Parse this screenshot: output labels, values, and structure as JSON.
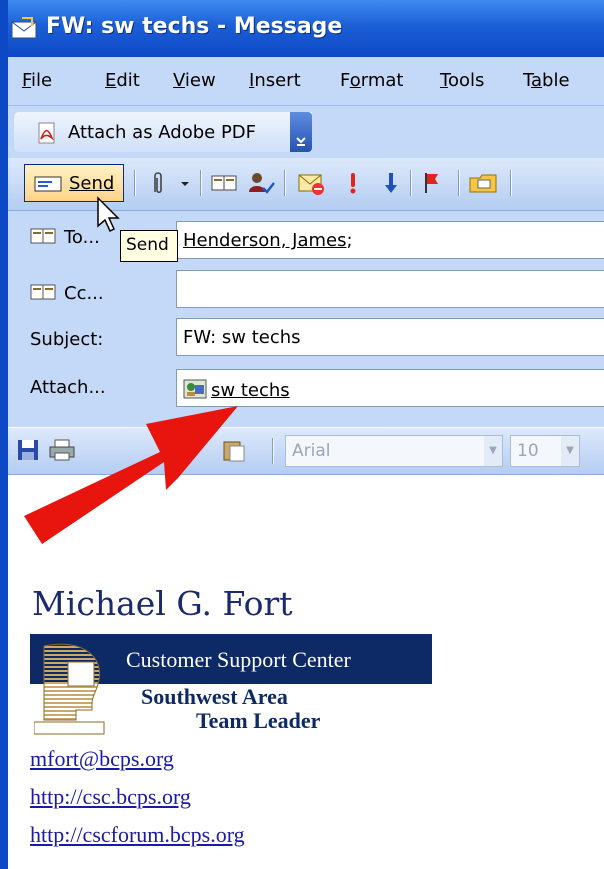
{
  "window": {
    "title": "FW: sw techs - Message"
  },
  "menu": {
    "items": [
      {
        "pre": "",
        "u": "F",
        "post": "ile"
      },
      {
        "pre": "",
        "u": "E",
        "post": "dit"
      },
      {
        "pre": "",
        "u": "V",
        "post": "iew"
      },
      {
        "pre": "",
        "u": "I",
        "post": "nsert"
      },
      {
        "pre": "F",
        "u": "o",
        "post": "rmat"
      },
      {
        "pre": "",
        "u": "T",
        "post": "ools"
      },
      {
        "pre": "T",
        "u": "a",
        "post": "ble"
      }
    ]
  },
  "pdf_toolbar": {
    "attach_label": "Attach as Adobe PDF"
  },
  "std_toolbar": {
    "send_label": "Send"
  },
  "tooltip": {
    "text": "Send"
  },
  "header": {
    "to_label": "To...",
    "to_value": "Henderson, James",
    "to_sep": ";",
    "cc_label": "Cc...",
    "cc_value": "",
    "subject_label": "Subject:",
    "subject_value": "FW: sw techs",
    "attach_label": "Attach...",
    "attach_value": "sw techs"
  },
  "format_toolbar": {
    "font": "Arial",
    "size": "10"
  },
  "signature": {
    "name": "Michael G. Fort",
    "banner": "Customer Support Center",
    "area": "Southwest Area",
    "role": "Team Leader",
    "email": "mfort@bcps.org",
    "link1": "http://csc.bcps.org",
    "link2": "http://cscforum.bcps.org"
  },
  "colors": {
    "titlebar": "#0d49c5",
    "toolbar": "#c3d9f7",
    "arrow": "#e8140e",
    "banner": "#0d2a66"
  }
}
